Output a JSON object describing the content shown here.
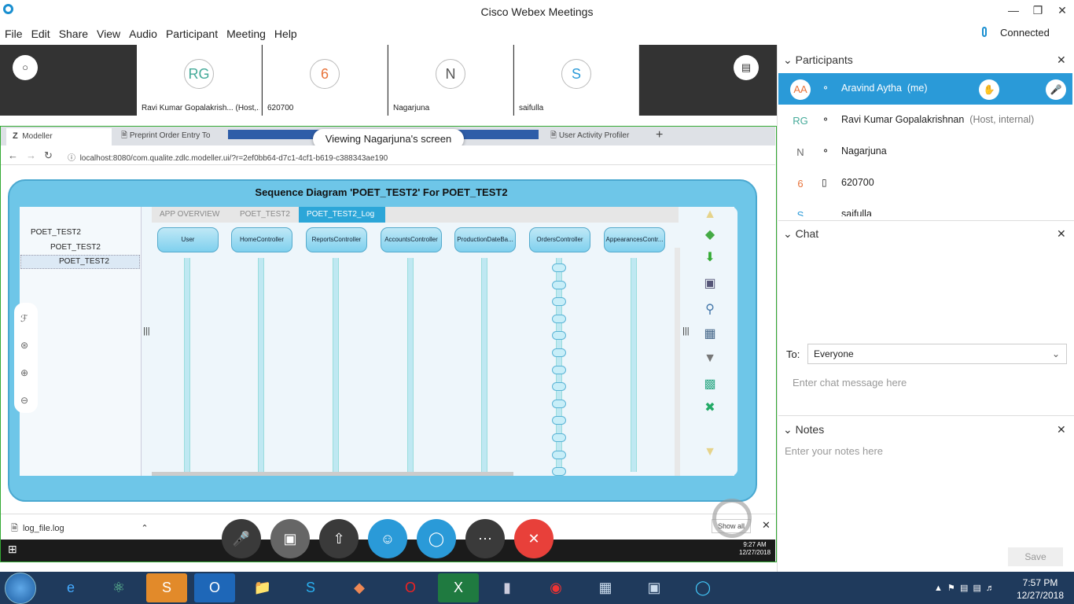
{
  "window": {
    "title": "Cisco Webex Meetings",
    "status": "Connected"
  },
  "menu": [
    "File",
    "Edit",
    "Share",
    "View",
    "Audio",
    "Participant",
    "Meeting",
    "Help"
  ],
  "video_tiles": [
    {
      "initials": "RG",
      "name": "Ravi Kumar Gopalakrish... (Host,...",
      "color": "#4a9"
    },
    {
      "initials": "6",
      "name": "620700",
      "color": "#e8733a"
    },
    {
      "initials": "N",
      "name": "Nagarjuna",
      "color": "#555"
    },
    {
      "initials": "S",
      "name": "saifulla",
      "color": "#2a9ad8"
    }
  ],
  "viewing_banner": "Viewing Nagarjuna's screen",
  "browser": {
    "tabs": [
      "Modeller",
      "Preprint Order Entry To",
      "User Activity Profiler"
    ],
    "url": "localhost:8080/com.qualite.zdlc.modeller.ui/?r=2ef0bb64-d7c1-4cf1-b619-c388343ae190"
  },
  "app": {
    "title": "Sequence Diagram 'POET_TEST2' For POET_TEST2",
    "tree": [
      "POET_TEST2",
      "POET_TEST2",
      "POET_TEST2"
    ],
    "breadcrumbs": [
      "APP OVERVIEW",
      "POET_TEST2",
      "POET_TEST2_Log"
    ],
    "controllers": [
      "User",
      "HomeController",
      "ReportsController",
      "AccountsController",
      "ProductionDateBa...",
      "OrdersController",
      "AppearancesContr..."
    ]
  },
  "download": {
    "file": "log_file.log",
    "show_all": "Show all"
  },
  "inner_clock": {
    "time": "9:27 AM",
    "date": "12/27/2018"
  },
  "participants": {
    "header": "Participants",
    "list": [
      {
        "initials": "AA",
        "name": "Aravind Aytha",
        "tag": "(me)",
        "color": "#e8733a"
      },
      {
        "initials": "RG",
        "name": "Ravi Kumar Gopalakrishnan",
        "tag": "(Host, internal)",
        "color": "#4a9"
      },
      {
        "initials": "N",
        "name": "Nagarjuna",
        "tag": "",
        "color": "#666"
      },
      {
        "initials": "6",
        "name": "620700",
        "tag": "",
        "color": "#e8733a"
      },
      {
        "initials": "S",
        "name": "saifulla",
        "tag": "",
        "color": "#2a9ad8"
      }
    ]
  },
  "chat": {
    "header": "Chat",
    "to_label": "To:",
    "to_value": "Everyone",
    "placeholder": "Enter chat message here"
  },
  "notes": {
    "header": "Notes",
    "placeholder": "Enter your notes here",
    "save": "Save"
  },
  "clock": {
    "time": "7:57 PM",
    "date": "12/27/2018"
  }
}
